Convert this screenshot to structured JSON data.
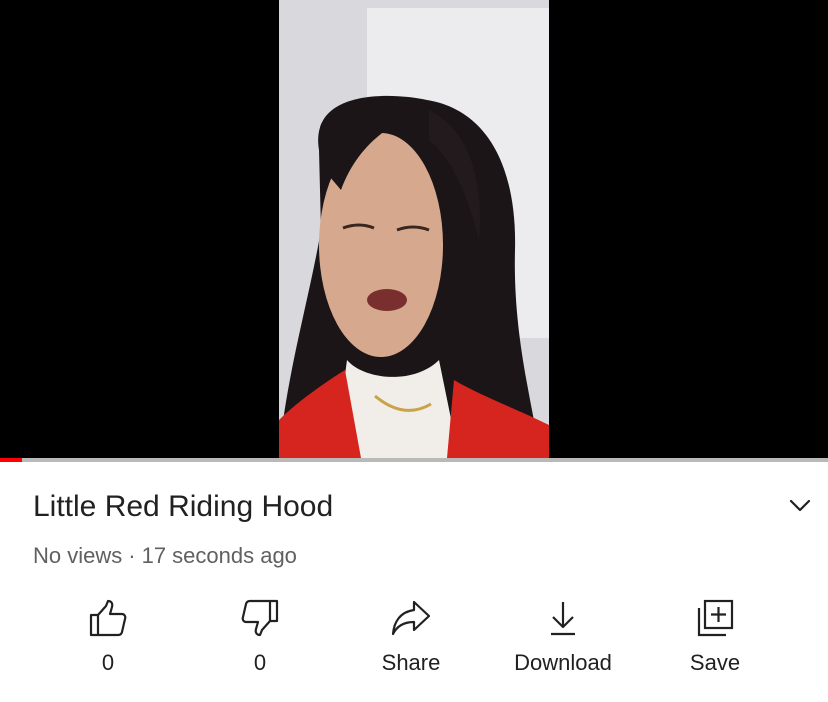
{
  "video": {
    "title": "Little Red Riding Hood",
    "views": "No views",
    "separator": "·",
    "uploaded": "17 seconds ago",
    "progress_fraction": 0.026
  },
  "actions": {
    "like_count": "0",
    "dislike_count": "0",
    "share_label": "Share",
    "download_label": "Download",
    "save_label": "Save"
  },
  "icons": {
    "like": "thumbs-up-icon",
    "dislike": "thumbs-down-icon",
    "share": "share-arrow-icon",
    "download": "download-icon",
    "save": "add-to-playlist-icon",
    "expand": "chevron-down-icon"
  },
  "colors": {
    "progress": "#ff0000",
    "track": "#b9b9b9",
    "text_primary": "#212121",
    "text_secondary": "#606060"
  }
}
